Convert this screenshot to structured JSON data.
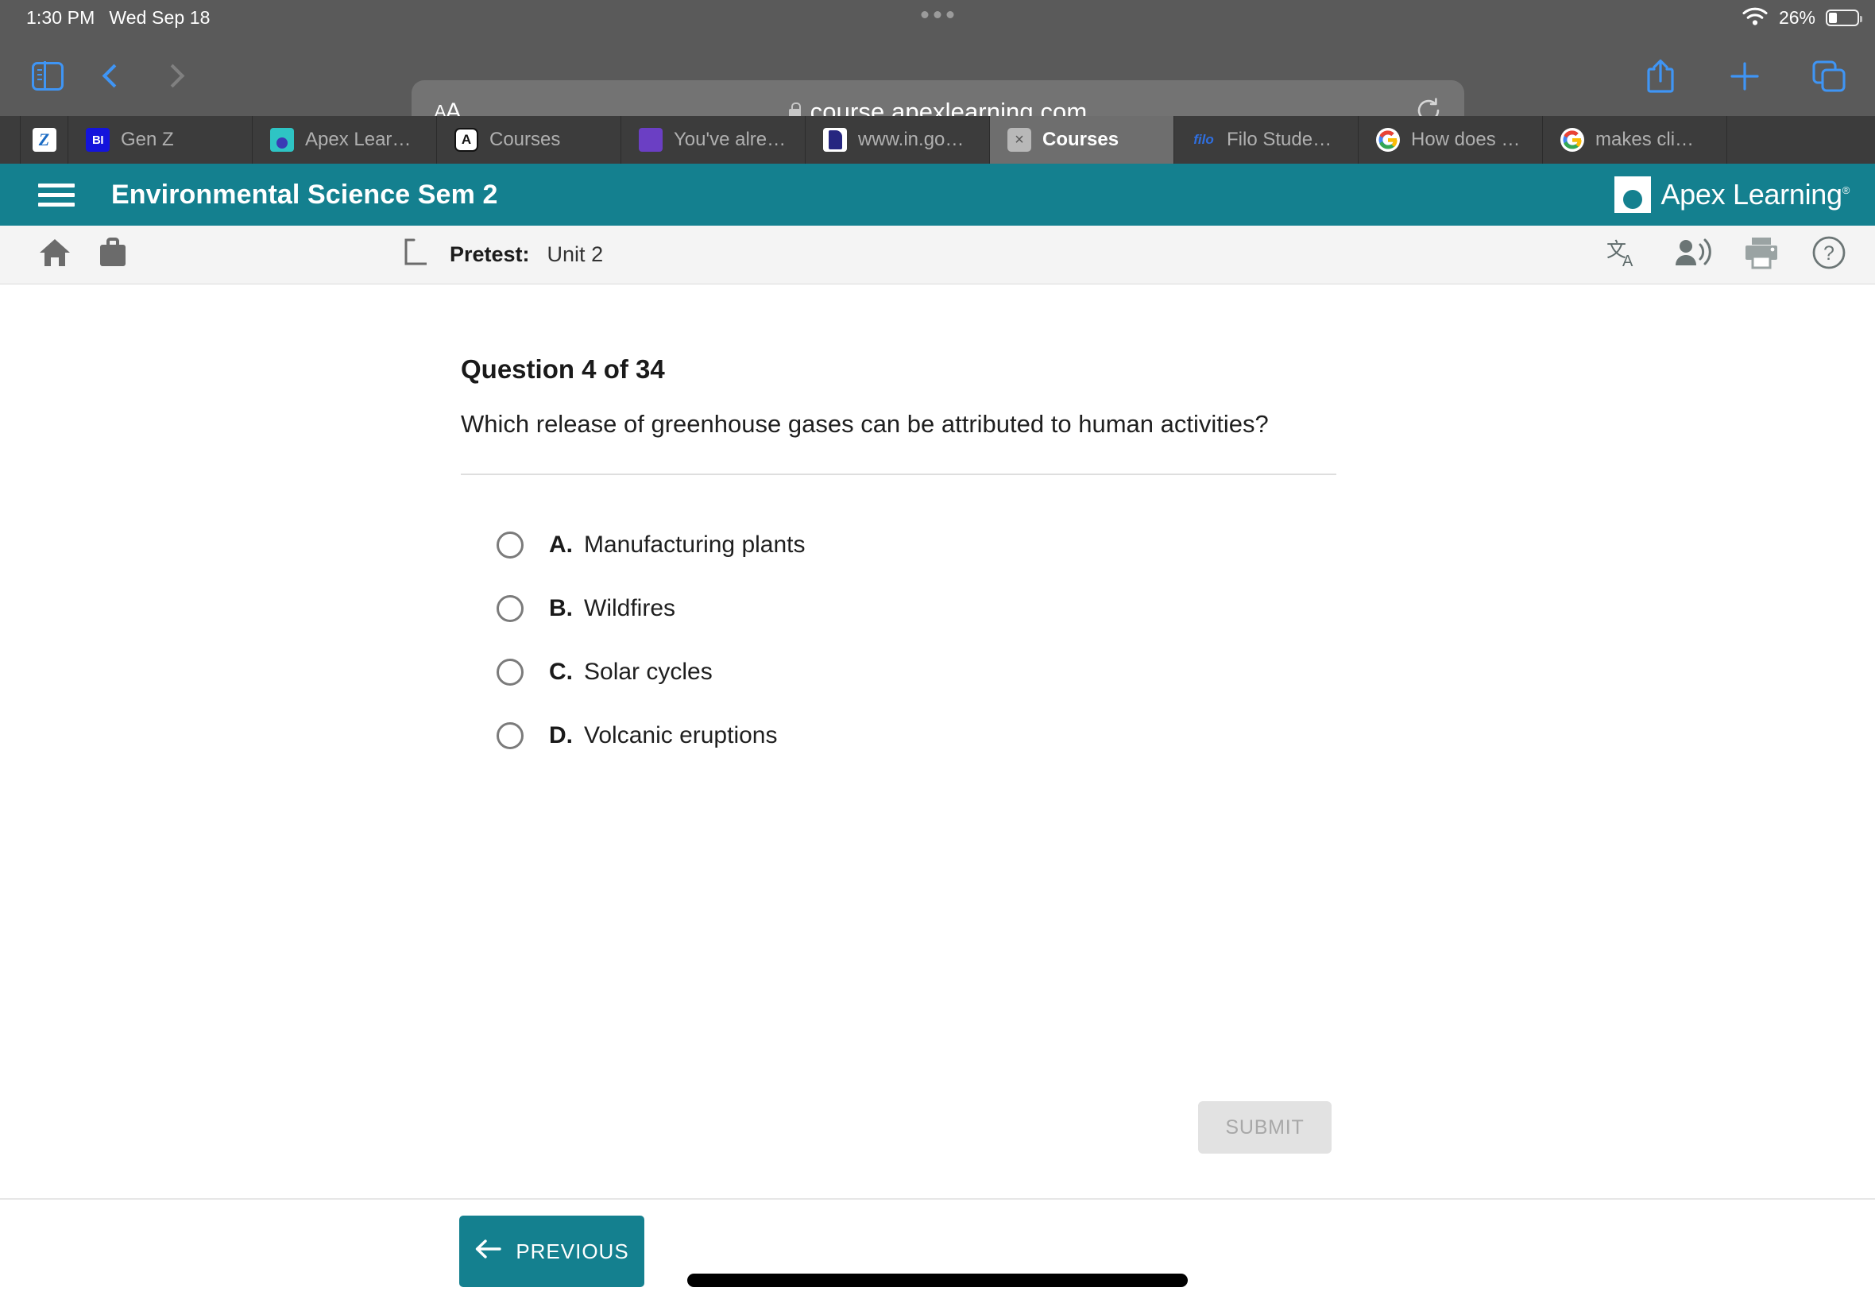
{
  "status_bar": {
    "time": "1:30 PM",
    "date": "Wed Sep 18",
    "battery_percent": "26%",
    "wifi_icon": "wifi-icon",
    "battery_icon": "battery-icon"
  },
  "browser": {
    "sidebar_icon": "sidebar-icon",
    "back_icon": "chevron-left-icon",
    "forward_icon": "chevron-right-icon",
    "text_size_label": "AA",
    "lock_icon": "lock-icon",
    "url": "course.apexlearning.com",
    "reload_icon": "reload-icon",
    "share_icon": "share-icon",
    "new_tab_icon": "plus-icon",
    "tabs_overview_icon": "tabs-overview-icon",
    "tabs": [
      {
        "title": "",
        "favicon": "zoom-icon",
        "active": false,
        "narrow": true
      },
      {
        "title": "Gen Z",
        "favicon": "business-insider-icon",
        "active": false,
        "narrow": false
      },
      {
        "title": "Apex Learning",
        "favicon": "apex-learning-icon",
        "active": false,
        "narrow": false
      },
      {
        "title": "Courses",
        "favicon": "apex-a-icon",
        "active": false,
        "narrow": false
      },
      {
        "title": "You've alrea...",
        "favicon": "list-icon",
        "active": false,
        "narrow": false
      },
      {
        "title": "www.in.gov/...",
        "favicon": "document-icon",
        "active": false,
        "narrow": false
      },
      {
        "title": "Courses",
        "favicon": "close-icon",
        "active": true,
        "narrow": false
      },
      {
        "title": "Filo Student:...",
        "favicon": "filo-icon",
        "active": false,
        "narrow": false
      },
      {
        "title": "How does de...",
        "favicon": "google-icon",
        "active": false,
        "narrow": false
      },
      {
        "title": "makes clima...",
        "favicon": "google-icon",
        "active": false,
        "narrow": false
      }
    ]
  },
  "app_header": {
    "menu_icon": "hamburger-menu-icon",
    "course_title": "Environmental Science Sem 2",
    "logo_text": "Apex Learning",
    "logo_trademark": "®",
    "background_color": "#14808f"
  },
  "sub_toolbar": {
    "home_icon": "home-icon",
    "briefcase_icon": "briefcase-icon",
    "up_icon": "up-level-icon",
    "breadcrumb_label": "Pretest:",
    "breadcrumb_value": "Unit 2",
    "translate_icon": "translate-icon",
    "read_aloud_icon": "read-aloud-icon",
    "print_icon": "print-icon",
    "help_icon": "help-icon"
  },
  "question": {
    "heading": "Question 4 of 34",
    "prompt": "Which release of greenhouse gases can be attributed to human activities?",
    "options": [
      {
        "letter": "A.",
        "text": "Manufacturing plants",
        "selected": false
      },
      {
        "letter": "B.",
        "text": "Wildfires",
        "selected": false
      },
      {
        "letter": "C.",
        "text": "Solar cycles",
        "selected": false
      },
      {
        "letter": "D.",
        "text": "Volcanic eruptions",
        "selected": false
      }
    ],
    "submit_label": "SUBMIT",
    "submit_disabled": true
  },
  "footer": {
    "previous_label": "PREVIOUS",
    "previous_icon": "arrow-left-icon"
  }
}
